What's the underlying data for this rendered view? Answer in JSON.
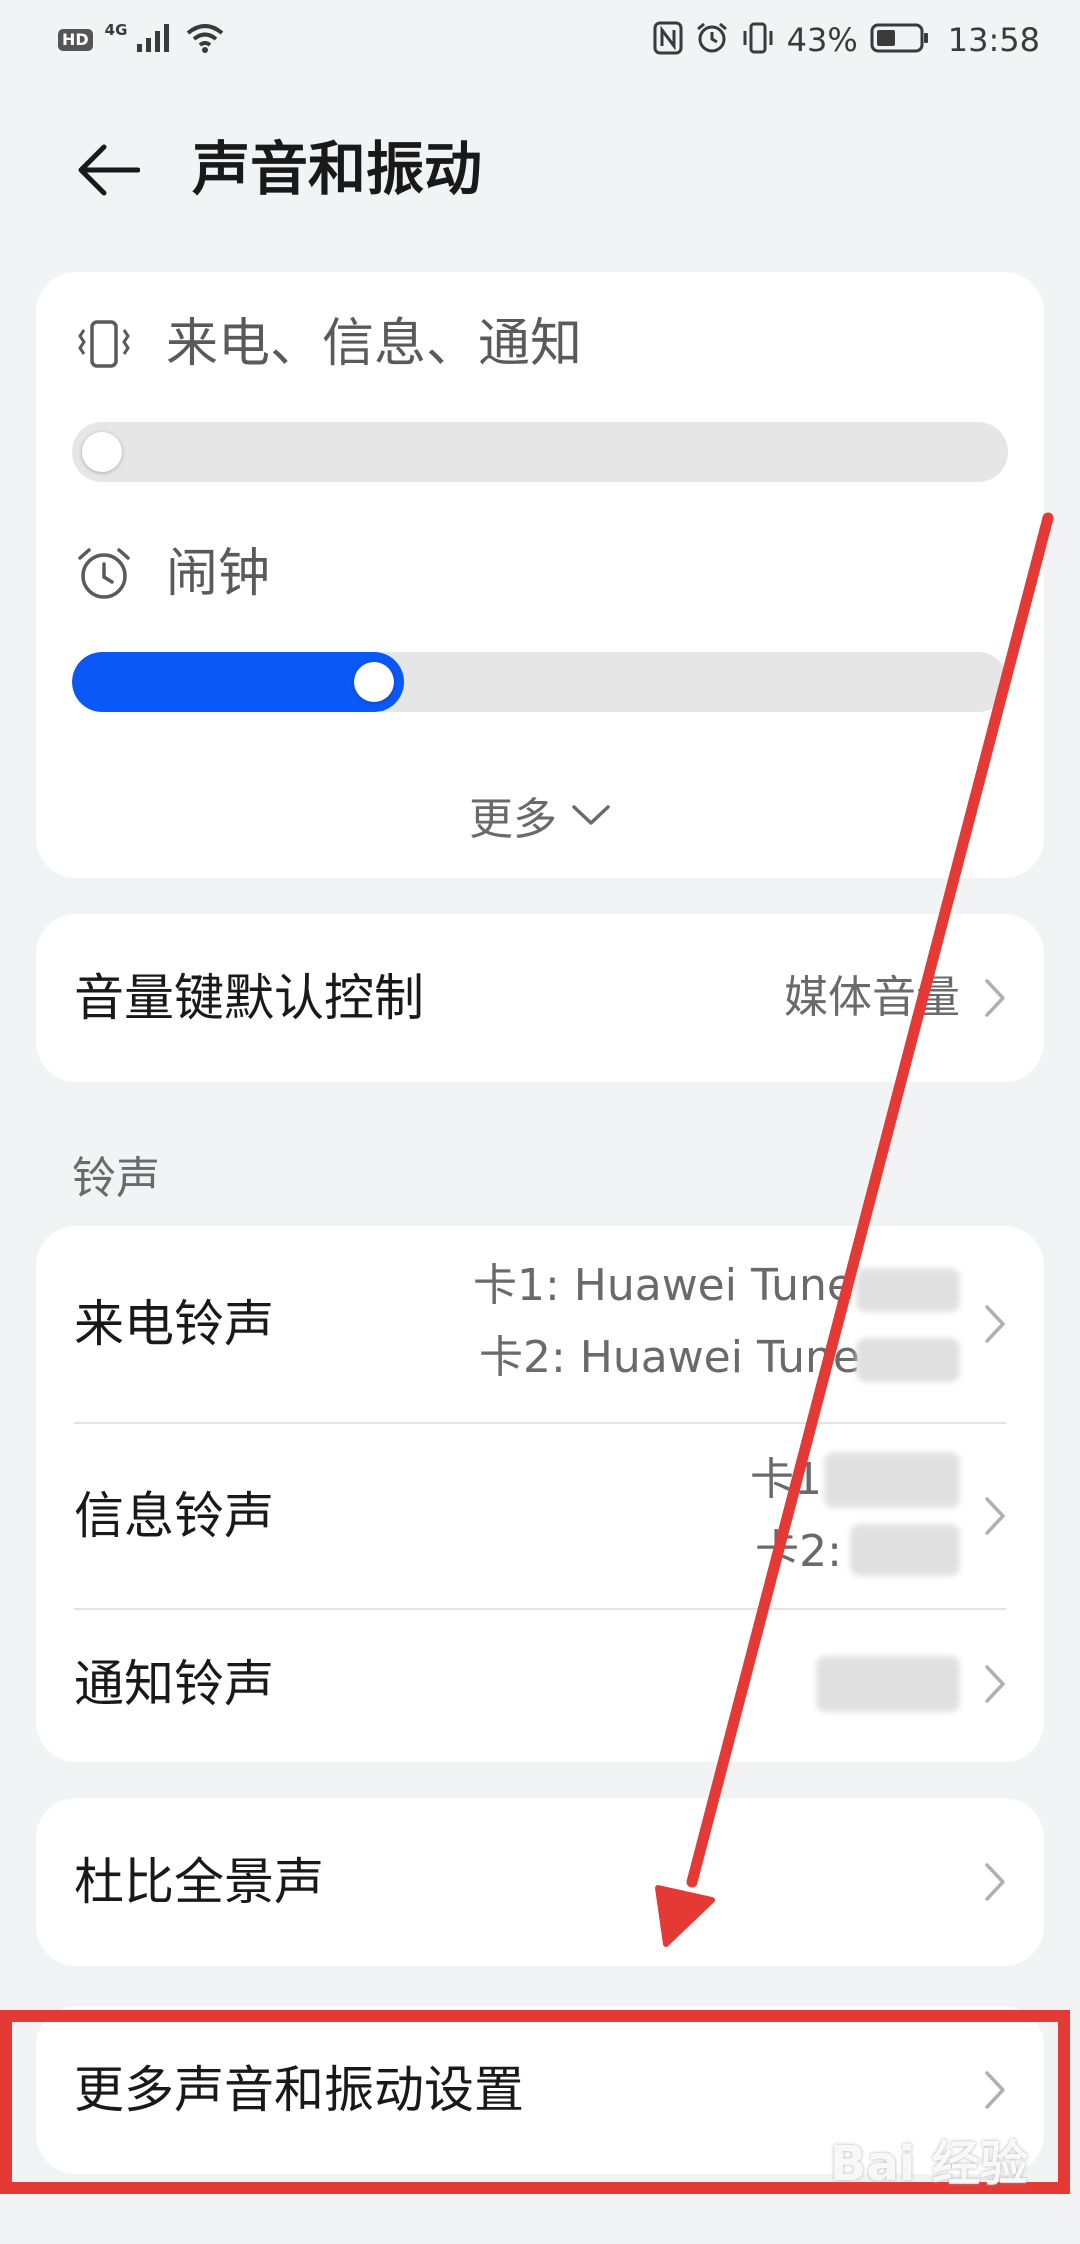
{
  "status_bar": {
    "hd": "HD",
    "network": "4G",
    "battery": "43%",
    "time": "13:58"
  },
  "header": {
    "title": "声音和振动"
  },
  "volume": {
    "ringer_label": "来电、信息、通知",
    "ringer_level": 0.0,
    "alarm_label": "闹钟",
    "alarm_level": 0.31,
    "more_label": "更多",
    "accent_color": "#0a59f7"
  },
  "volume_key": {
    "title": "音量键默认控制",
    "value": "媒体音量"
  },
  "ringtones": {
    "section_label": "铃声",
    "call": {
      "title": "来电铃声",
      "value_line1": "卡1: Huawei Tune",
      "value_line2": "卡2: Huawei Tune"
    },
    "message": {
      "title": "信息铃声",
      "value_line1": "卡1",
      "value_line2": "卡2:"
    },
    "notification": {
      "title": "通知铃声"
    }
  },
  "dolby": {
    "title": "杜比全景声"
  },
  "more_settings": {
    "title": "更多声音和振动设置"
  },
  "annotation": {
    "color": "#e53935"
  },
  "watermark": {
    "text": "Bai 经验"
  }
}
